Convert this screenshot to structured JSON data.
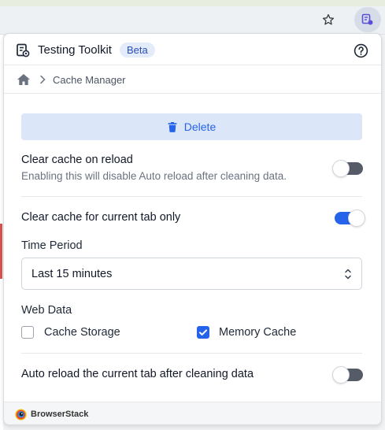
{
  "header": {
    "title": "Testing Toolkit",
    "badge": "Beta"
  },
  "breadcrumb": {
    "current": "Cache Manager"
  },
  "actions": {
    "delete_label": "Delete"
  },
  "settings": {
    "clear_on_reload": {
      "title": "Clear cache on reload",
      "description": "Enabling this will disable Auto reload after cleaning data.",
      "enabled": false
    },
    "current_tab_only": {
      "title": "Clear cache for current tab only",
      "enabled": true
    },
    "time_period": {
      "label": "Time Period",
      "selected": "Last 15 minutes"
    },
    "web_data": {
      "label": "Web Data",
      "options": [
        {
          "label": "Cache Storage",
          "checked": false
        },
        {
          "label": "Memory Cache",
          "checked": true
        }
      ]
    },
    "auto_reload": {
      "title": "Auto reload the current tab after cleaning data",
      "enabled": false
    }
  },
  "footer": {
    "brand": "BrowserStack"
  },
  "colors": {
    "accent": "#2563eb",
    "delete_bg": "#dbe6f8",
    "badge_bg": "#e4ecfb",
    "toggle_off": "#555b67"
  },
  "icons": {
    "browser_star": "star-icon",
    "extension": "extension-icon",
    "app_logo": "toolkit-logo-icon",
    "help": "help-circle-icon",
    "home": "home-icon",
    "chevron": "chevron-right-icon",
    "delete": "trash-icon",
    "select_arrows": "chevron-up-down-icon",
    "checkmark": "check-icon",
    "brand_logo": "browserstack-logo-icon"
  }
}
